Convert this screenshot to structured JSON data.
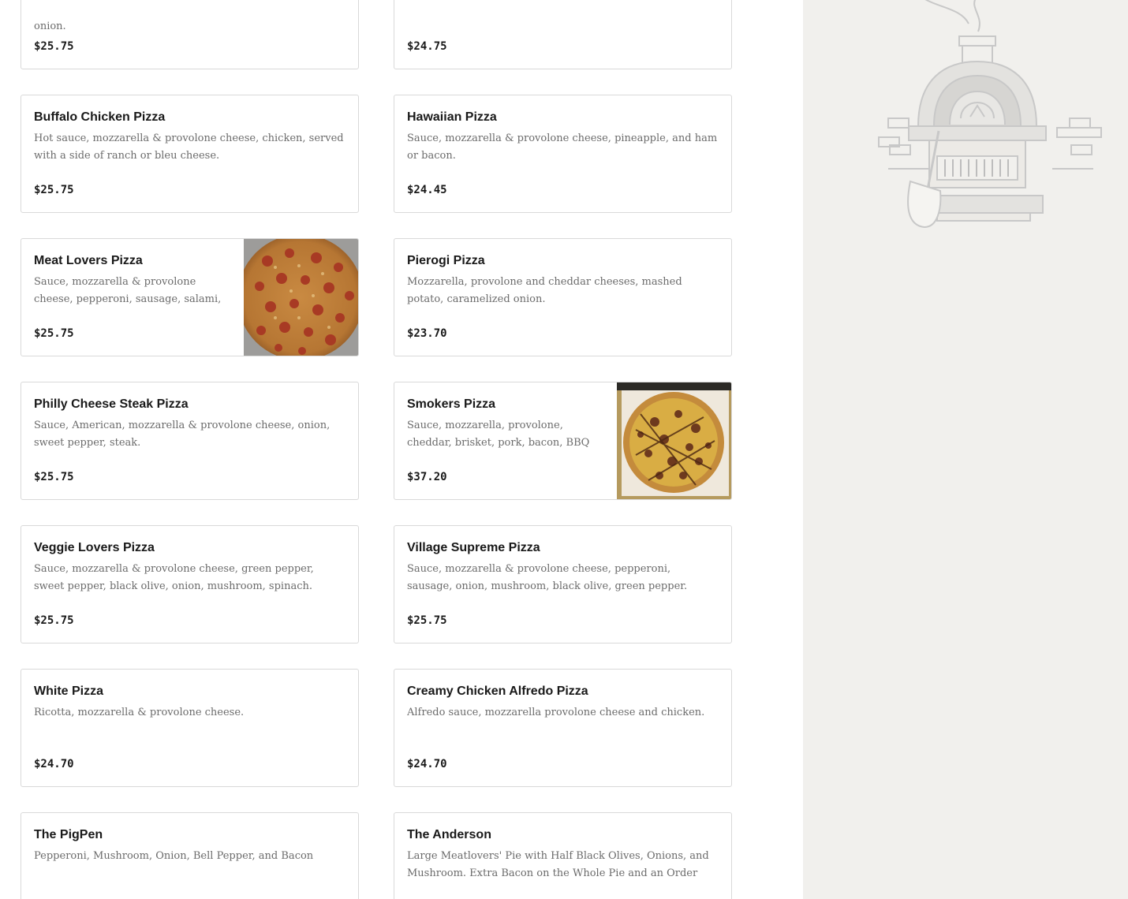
{
  "menu": {
    "items": [
      {
        "name": "",
        "description": "onion.",
        "price": "$25.75",
        "has_image": false
      },
      {
        "name": "",
        "description": "",
        "price": "$24.75",
        "has_image": false
      },
      {
        "name": "Buffalo Chicken Pizza",
        "description": "Hot sauce, mozzarella & provolone cheese, chicken, served with a side of ranch or bleu cheese.",
        "price": "$25.75",
        "has_image": false
      },
      {
        "name": "Hawaiian Pizza",
        "description": "Sauce, mozzarella & provolone cheese, pineapple, and ham or bacon.",
        "price": "$24.45",
        "has_image": false
      },
      {
        "name": "Meat Lovers Pizza",
        "description": "Sauce, mozzarella & provolone cheese, pepperoni, sausage, salami, ham,...",
        "price": "$25.75",
        "has_image": true,
        "image": "pepperoni-pizza-photo"
      },
      {
        "name": "Pierogi Pizza",
        "description": "Mozzarella, provolone and cheddar cheeses, mashed potato, caramelized onion.",
        "price": "$23.70",
        "has_image": false
      },
      {
        "name": "Philly Cheese Steak Pizza",
        "description": "Sauce, American, mozzarella & provolone cheese, onion, sweet pepper, steak.",
        "price": "$25.75",
        "has_image": false
      },
      {
        "name": "Smokers Pizza",
        "description": "Sauce, mozzarella, provolone, cheddar, brisket, pork, bacon, BBQ sauce.",
        "price": "$37.20",
        "has_image": true,
        "image": "bbq-pizza-in-box-photo"
      },
      {
        "name": "Veggie Lovers Pizza",
        "description": "Sauce, mozzarella & provolone cheese, green pepper, sweet pepper, black olive, onion, mushroom, spinach.",
        "price": "$25.75",
        "has_image": false
      },
      {
        "name": "Village Supreme Pizza",
        "description": "Sauce, mozzarella & provolone cheese, pepperoni, sausage, onion, mushroom, black olive, green pepper.",
        "price": "$25.75",
        "has_image": false
      },
      {
        "name": "White Pizza",
        "description": "Ricotta, mozzarella & provolone cheese.",
        "price": "$24.70",
        "has_image": false
      },
      {
        "name": "Creamy Chicken Alfredo Pizza",
        "description": "Alfredo sauce, mozzarella provolone cheese and chicken.",
        "price": "$24.70",
        "has_image": false
      },
      {
        "name": "The PigPen",
        "description": "Pepperoni, Mushroom, Onion, Bell Pepper, and Bacon",
        "price": "",
        "has_image": false
      },
      {
        "name": "The Anderson",
        "description": "Large Meatlovers' Pie with Half Black Olives, Onions, and Mushroom. Extra Bacon on the Whole Pie and an Order of...",
        "price": "",
        "has_image": false
      }
    ]
  },
  "side_panel": {
    "illustration": "pizza-oven-illustration"
  }
}
